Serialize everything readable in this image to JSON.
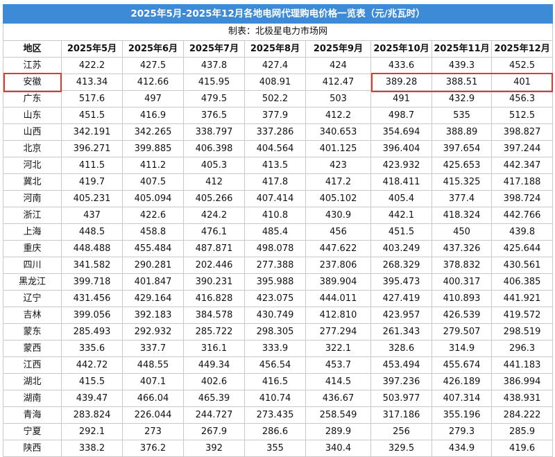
{
  "table": {
    "title": "2025年5月-2025年12月各地电网代理购电价格一览表（元/兆瓦时）",
    "source": "制表：北极星电力市场网",
    "columns": [
      "地区",
      "2025年5月",
      "2025年6月",
      "2025年7月",
      "2025年8月",
      "2025年9月",
      "2025年10月",
      "2025年11月",
      "2025年12月"
    ],
    "rows": [
      [
        "江苏",
        "422.2",
        "427.5",
        "437.8",
        "427.4",
        "424",
        "433.6",
        "439.3",
        "452.5"
      ],
      [
        "安徽",
        "413.34",
        "412.66",
        "415.95",
        "408.91",
        "412.47",
        "389.28",
        "388.51",
        "401"
      ],
      [
        "广东",
        "517.6",
        "497",
        "479.5",
        "502.2",
        "503",
        "491",
        "432.9",
        "456.3"
      ],
      [
        "山东",
        "451.5",
        "416.9",
        "376.5",
        "377.9",
        "412.2",
        "498.7",
        "535",
        "512.5"
      ],
      [
        "山西",
        "342.191",
        "342.265",
        "338.797",
        "337.286",
        "340.653",
        "354.694",
        "388.89",
        "398.827"
      ],
      [
        "北京",
        "396.271",
        "399.885",
        "406.398",
        "404.564",
        "401.125",
        "396.404",
        "397.654",
        "397.244"
      ],
      [
        "河北",
        "411.5",
        "411.2",
        "405.3",
        "413.5",
        "423",
        "423.932",
        "425.653",
        "442.347"
      ],
      [
        "冀北",
        "419.7",
        "407.5",
        "412",
        "417.8",
        "417.2",
        "418.411",
        "415.325",
        "417.188"
      ],
      [
        "河南",
        "405.231",
        "405.094",
        "405.266",
        "407.414",
        "405.102",
        "405.4",
        "377.4",
        "398.724"
      ],
      [
        "浙江",
        "437",
        "422.6",
        "424.2",
        "410.8",
        "430.9",
        "442.1",
        "418.324",
        "442.766"
      ],
      [
        "上海",
        "448.5",
        "458.8",
        "476.1",
        "485.4",
        "456",
        "451.5",
        "450",
        "439.8"
      ],
      [
        "重庆",
        "448.488",
        "455.484",
        "487.871",
        "498.078",
        "447.622",
        "403.249",
        "437.326",
        "425.644"
      ],
      [
        "四川",
        "341.582",
        "290.281",
        "202.446",
        "277.388",
        "237.806",
        "268.329",
        "378.832",
        "430.561"
      ],
      [
        "黑龙江",
        "399.718",
        "401.847",
        "390.231",
        "395.988",
        "389.904",
        "395.473",
        "400.317",
        "406.385"
      ],
      [
        "辽宁",
        "431.456",
        "429.164",
        "416.828",
        "423.075",
        "444.011",
        "427.419",
        "410.893",
        "441.921"
      ],
      [
        "吉林",
        "399.056",
        "392.183",
        "384.578",
        "430.749",
        "412.810",
        "423.957",
        "426.539",
        "419.572"
      ],
      [
        "蒙东",
        "285.493",
        "292.932",
        "285.722",
        "298.305",
        "277.294",
        "261.343",
        "279.507",
        "298.519"
      ],
      [
        "蒙西",
        "335.6",
        "337.7",
        "316.1",
        "333.9",
        "322.1",
        "328.6",
        "314.9",
        "296.3"
      ],
      [
        "江西",
        "442.72",
        "448.55",
        "449.34",
        "456.54",
        "453.7",
        "453.494",
        "455.674",
        "441.183"
      ],
      [
        "湖北",
        "415.5",
        "407.1",
        "402.6",
        "416.5",
        "414.5",
        "397.236",
        "426.189",
        "386.994"
      ],
      [
        "湖南",
        "439.47",
        "466.04",
        "465.39",
        "410.74",
        "436.67",
        "503.977",
        "407.314",
        "438.931"
      ],
      [
        "青海",
        "283.824",
        "226.044",
        "244.727",
        "273.435",
        "258.549",
        "317.186",
        "355.196",
        "284.222"
      ],
      [
        "宁夏",
        "292.1",
        "273",
        "267.9",
        "286.6",
        "289.9",
        "256",
        "279.3",
        "285.9"
      ],
      [
        "陕西",
        "338.2",
        "376.2",
        "392",
        "355",
        "340.4",
        "329.5",
        "434.9",
        "419.6"
      ]
    ],
    "highlight_row_region": "安徽",
    "highlight_color": "#e8332f",
    "title_bg_color": "#3d8ad7"
  }
}
